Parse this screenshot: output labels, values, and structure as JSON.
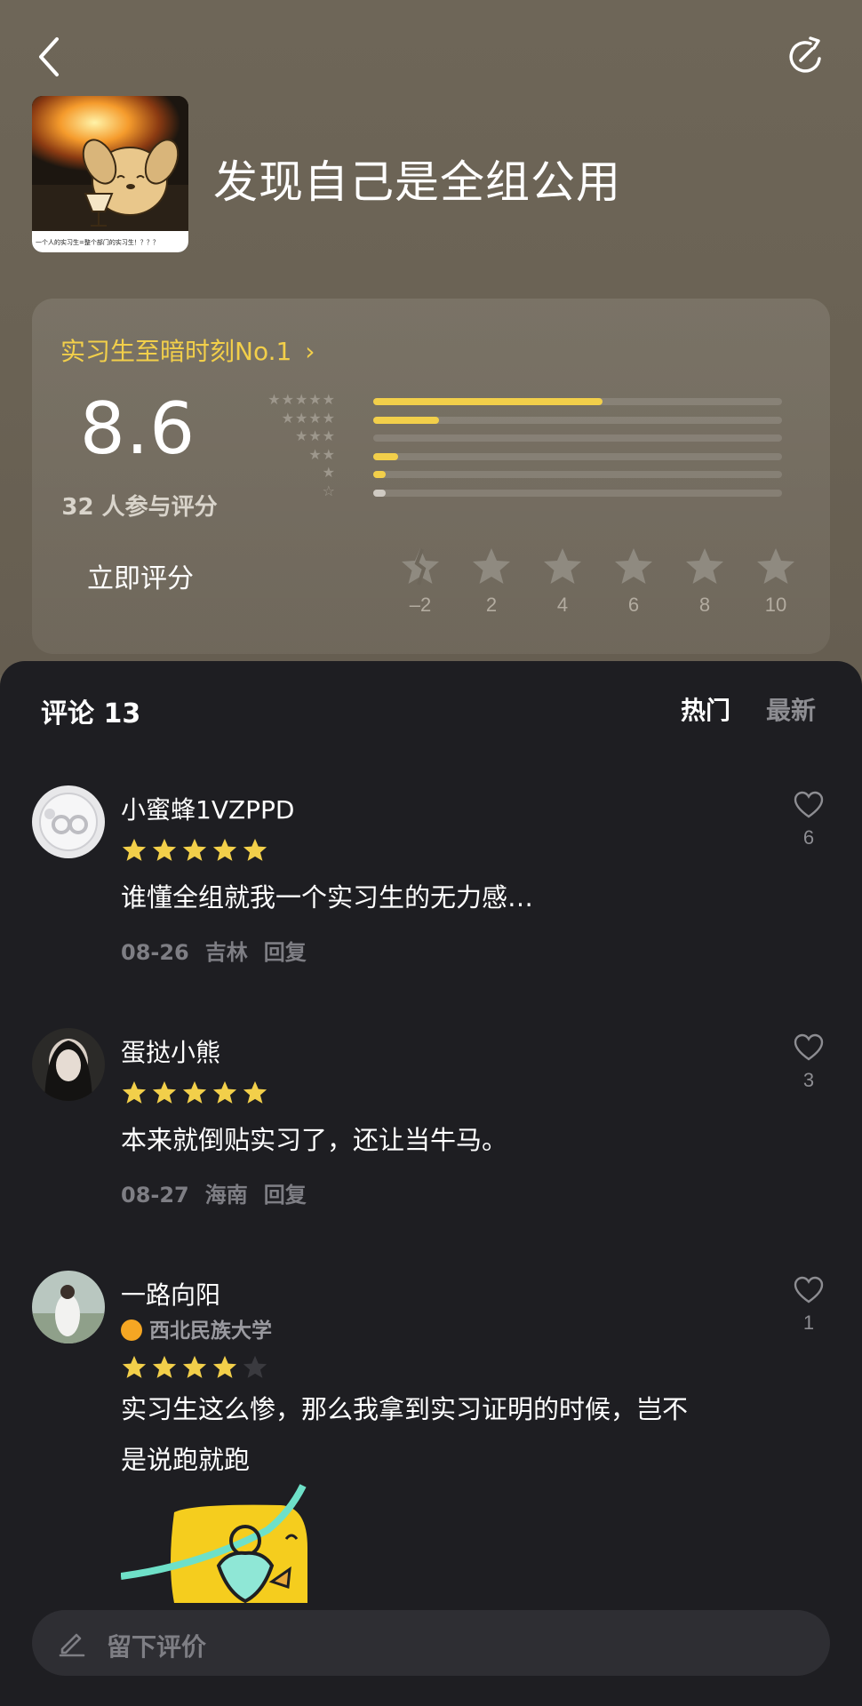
{
  "header": {
    "back_icon": "chevron-left-icon",
    "share_icon": "share-icon",
    "title": "发现自己是全组公用",
    "cover_caption": "一个人的实习生=整个部门的实习生！？？？"
  },
  "rating": {
    "rank_label": "实习生至暗时刻No.1",
    "score": "8.6",
    "participants": "32 人参与评分",
    "distribution": [
      {
        "stars": "★★★★★",
        "fraction": 0.56
      },
      {
        "stars": "★★★★",
        "fraction": 0.16
      },
      {
        "stars": "★★★",
        "fraction": 0.0
      },
      {
        "stars": "★★",
        "fraction": 0.06
      },
      {
        "stars": "★",
        "fraction": 0.03
      },
      {
        "stars": "☆",
        "fraction": 0.03
      }
    ],
    "rate_now_label": "立即评分",
    "options": [
      "–2",
      "2",
      "4",
      "6",
      "8",
      "10"
    ]
  },
  "comments_section": {
    "title": "评论 13",
    "sort_hot": "热门",
    "sort_new": "最新",
    "reply_label": "回复",
    "comments": [
      {
        "user": "小蜜蜂1VZPPD",
        "stars": 5,
        "text": "谁懂全组就我一个实习生的无力感…",
        "date": "08-26",
        "location": "吉林",
        "likes": "6"
      },
      {
        "user": "蛋挞小熊",
        "stars": 5,
        "text": "本来就倒贴实习了，还让当牛马。",
        "date": "08-27",
        "location": "海南",
        "likes": "3"
      },
      {
        "user": "一路向阳",
        "school": "西北民族大学",
        "stars": 4,
        "text_line1": "实习生这么惨，那么我拿到实习证明的时候，岂不",
        "text_line2": "是说跑就跑",
        "likes": "1"
      }
    ]
  },
  "input": {
    "placeholder": "留下评价",
    "icon": "pen-icon"
  },
  "colors": {
    "accent": "#f2cf4a",
    "sheet_bg": "#1e1e22",
    "top_bg": "#6b6356"
  }
}
